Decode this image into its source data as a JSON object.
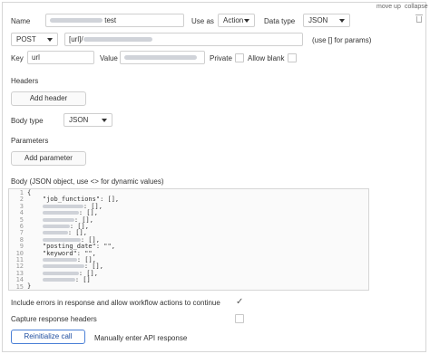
{
  "top_links": {
    "move_up": "move up",
    "collapse": "collapse"
  },
  "name": {
    "label": "Name",
    "value_suffix": " test"
  },
  "use_as": {
    "label": "Use as",
    "value": "Action"
  },
  "data_type": {
    "label": "Data type",
    "value": "JSON"
  },
  "method": {
    "value": "POST"
  },
  "url": {
    "prefix": "[url]/"
  },
  "params_hint": "(use [] for params)",
  "key": {
    "label": "Key",
    "value": "url"
  },
  "value": {
    "label": "Value"
  },
  "private_label": "Private",
  "allow_blank_label": "Allow blank",
  "headers": {
    "label": "Headers",
    "add_button": "Add header"
  },
  "body_type": {
    "label": "Body type",
    "value": "JSON"
  },
  "parameters": {
    "label": "Parameters",
    "add_button": "Add parameter"
  },
  "body_label": "Body (JSON object, use <> for dynamic values)",
  "code": {
    "line_numbers": [
      "1",
      "2",
      "3",
      "4",
      "5",
      "6",
      "7",
      "8",
      "9",
      "10",
      "11",
      "12",
      "13",
      "14",
      "15"
    ],
    "lines": [
      {
        "text": "{",
        "blur": 0
      },
      {
        "text": "    \"job_functions\": [],",
        "blur": 0
      },
      {
        "text": "    ",
        "blur": 45,
        "tail": ": [],"
      },
      {
        "text": "    ",
        "blur": 40,
        "tail": ": [],"
      },
      {
        "text": "    ",
        "blur": 35,
        "tail": ": [],"
      },
      {
        "text": "    ",
        "blur": 30,
        "tail": ": [],"
      },
      {
        "text": "    ",
        "blur": 28,
        "tail": ": [],"
      },
      {
        "text": "    ",
        "blur": 42,
        "tail": ": [],"
      },
      {
        "text": "    \"posting_date\": \"\",",
        "blur": 0
      },
      {
        "text": "    \"keyword\": \"\",",
        "blur": 0
      },
      {
        "text": "    ",
        "blur": 38,
        "tail": ": [],"
      },
      {
        "text": "    ",
        "blur": 46,
        "tail": ": [],"
      },
      {
        "text": "    ",
        "blur": 40,
        "tail": ": [],"
      },
      {
        "text": "    ",
        "blur": 36,
        "tail": ": []"
      },
      {
        "text": "}",
        "blur": 0
      }
    ]
  },
  "include_errors_label": "Include errors in response and allow workflow actions to continue",
  "capture_headers_label": "Capture response headers",
  "reinitialize_button": "Reinitialize call",
  "manual_label": "Manually enter API response",
  "colors": {
    "accent": "#4a7fd6",
    "border": "#cfcfcf"
  }
}
